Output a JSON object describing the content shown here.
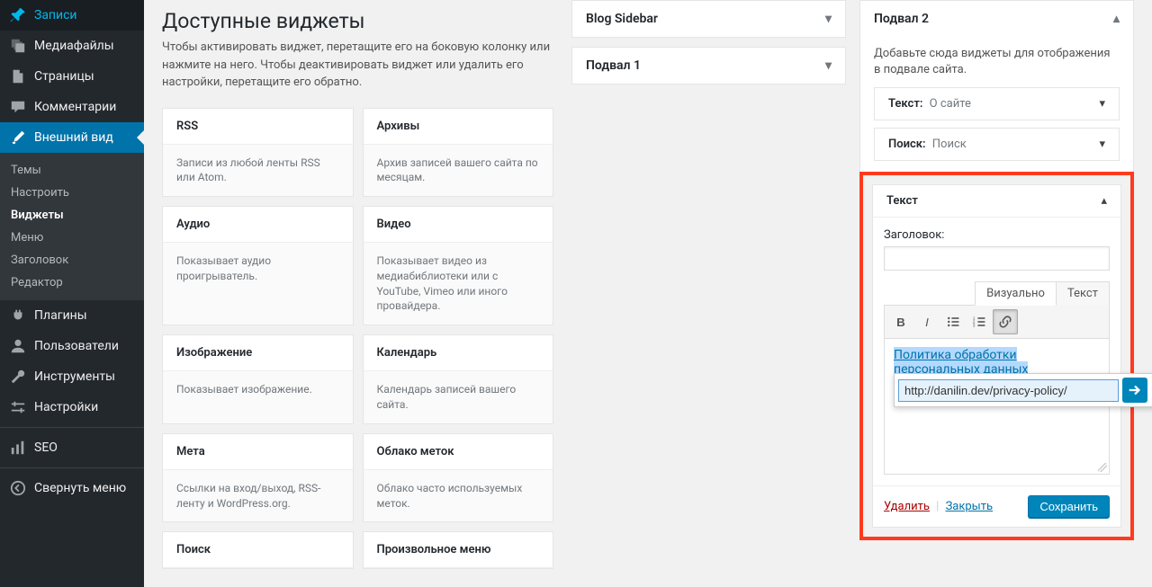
{
  "sidebar": {
    "posts": "Записи",
    "media": "Медиафайлы",
    "pages": "Страницы",
    "comments": "Комментарии",
    "appearance": "Внешний вид",
    "appearance_sub": {
      "themes": "Темы",
      "customize": "Настроить",
      "widgets": "Виджеты",
      "menus": "Меню",
      "header": "Заголовок",
      "editor": "Редактор"
    },
    "plugins": "Плагины",
    "users": "Пользователи",
    "tools": "Инструменты",
    "settings": "Настройки",
    "seo": "SEO",
    "collapse": "Свернуть меню"
  },
  "available": {
    "title": "Доступные виджеты",
    "desc": "Чтобы активировать виджет, перетащите его на боковую колонку или нажмите на него. Чтобы деактивировать виджет или удалить его настройки, перетащите его обратно.",
    "items": [
      {
        "name": "RSS",
        "desc": "Записи из любой ленты RSS или Atom."
      },
      {
        "name": "Архивы",
        "desc": "Архив записей вашего сайта по месяцам."
      },
      {
        "name": "Аудио",
        "desc": "Показывает аудио проигрыватель."
      },
      {
        "name": "Видео",
        "desc": "Показывает видео из медиабиблиотеки или с YouTube, Vimeo или иного провайдера."
      },
      {
        "name": "Изображение",
        "desc": "Показывает изображение."
      },
      {
        "name": "Календарь",
        "desc": "Календарь записей вашего сайта."
      },
      {
        "name": "Мета",
        "desc": "Ссылки на вход/выход, RSS-ленту и WordPress.org."
      },
      {
        "name": "Облако меток",
        "desc": "Облако часто используемых меток."
      },
      {
        "name": "Поиск",
        "desc": ""
      },
      {
        "name": "Произвольное меню",
        "desc": ""
      }
    ]
  },
  "areas": {
    "blog_sidebar": "Blog Sidebar",
    "footer1": "Подвал 1",
    "footer2": "Подвал 2",
    "footer2_desc": "Добавьте сюда виджеты для отображения в подвале сайта.",
    "text_widget_name": "Текст",
    "text_widget_inst": "О сайте",
    "search_widget_name": "Поиск",
    "search_widget_inst": "Поиск"
  },
  "editor": {
    "widget_name": "Текст",
    "title_label": "Заголовок:",
    "title_value": "",
    "tab_visual": "Визуально",
    "tab_text": "Текст",
    "link_text": "Политика обработки персональных данных",
    "url_value": "http://danilin.dev/privacy-policy/",
    "delete": "Удалить",
    "close": "Закрыть",
    "save": "Сохранить"
  }
}
